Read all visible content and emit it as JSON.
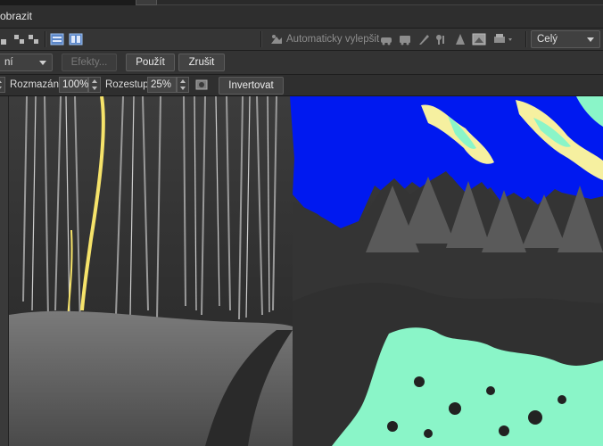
{
  "menubar": {
    "item_label": "obrazit"
  },
  "toolbar": {
    "auto_enhance_label": "Automaticky vylepšit",
    "zoom_value": "Celý"
  },
  "options_bar": {
    "mode_value": "ní",
    "effects_label": "Efekty...",
    "apply_label": "Použít",
    "cancel_label": "Zrušit"
  },
  "mask_bar": {
    "blur_label": "Rozmazání:",
    "blur_value": "100%",
    "spacing_label": "Rozestup:",
    "spacing_value": "25%",
    "invert_label": "Invertovat"
  },
  "icons": [
    "tile-icon",
    "tile-icon",
    "tile-icon",
    "view-icon",
    "grid-view-icon",
    "auto-enhance-icon",
    "car-icon",
    "bus-icon",
    "pen-icon",
    "pin-icon",
    "cone-icon",
    "photo-icon",
    "printer-icon",
    "mask-icon"
  ],
  "colors": {
    "sky_mask": "#0019f0",
    "vegetation_mask": "#8af5c8",
    "cloud_highlight": "#f6f0a0"
  }
}
